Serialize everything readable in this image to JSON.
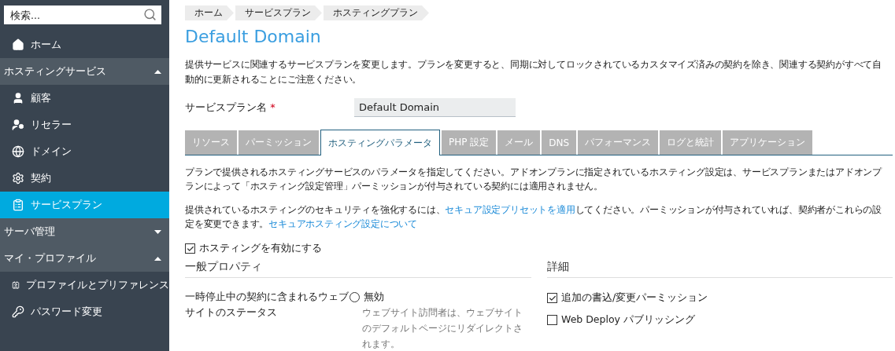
{
  "sidebar": {
    "search": {
      "placeholder": "検索..."
    },
    "nav": [
      {
        "kind": "link",
        "label": "ホーム",
        "selected": false
      },
      {
        "kind": "section",
        "label": "ホスティングサービス",
        "expanded": true,
        "children": [
          {
            "kind": "link",
            "label": "顧客",
            "selected": false
          },
          {
            "kind": "link",
            "label": "リセラー",
            "selected": false
          },
          {
            "kind": "link",
            "label": "ドメイン",
            "selected": false
          },
          {
            "kind": "link",
            "label": "契約",
            "selected": false
          },
          {
            "kind": "link",
            "label": "サービスプラン",
            "selected": true
          }
        ]
      },
      {
        "kind": "section",
        "label": "サーバ管理",
        "expanded": false
      },
      {
        "kind": "section",
        "label": "マイ・プロファイル",
        "expanded": true,
        "children": [
          {
            "kind": "link",
            "label": "プロファイルとプリファレンス",
            "selected": false
          },
          {
            "kind": "link",
            "label": "パスワード変更",
            "selected": false
          }
        ]
      }
    ]
  },
  "breadcrumbs": [
    "ホーム",
    "サービスプラン",
    "ホスティングプラン"
  ],
  "title": "Default Domain",
  "description": "提供サービスに関連するサービスプランを変更します。プランを変更すると、同期に対してロックされているカスタマイズ済みの契約を除き、関連する契約がすべて自動的に更新されることにご注意ください。",
  "plan_name": {
    "label": "サービスプラン名",
    "required_mark": "*",
    "value": "Default Domain"
  },
  "tabs": [
    {
      "label": "リソース",
      "selected": false
    },
    {
      "label": "パーミッション",
      "selected": false
    },
    {
      "label": "ホスティングパラメータ",
      "selected": true
    },
    {
      "label": "PHP 設定",
      "selected": false
    },
    {
      "label": "メール",
      "selected": false
    },
    {
      "label": "DNS",
      "selected": false
    },
    {
      "label": "パフォーマンス",
      "selected": false
    },
    {
      "label": "ログと統計",
      "selected": false
    },
    {
      "label": "アプリケーション",
      "selected": false
    }
  ],
  "paragraphs": [
    [
      {
        "kind": "text",
        "text": "プランで提供されるホスティングサービスのパラメータを指定してください。アドオンプランに指定されているホスティング設定は、サービスプランまたはアドオンプランによって「ホスティング設定管理」パーミッションが付与されている契約には適用されません。"
      }
    ],
    [
      {
        "kind": "text",
        "text": "提供されているホスティングのセキュリティを強化するには、"
      },
      {
        "kind": "link",
        "text": "セキュア設定プリセットを適用"
      },
      {
        "kind": "text",
        "text": "してください。パーミッションが付与されていれば、契約者がこれらの設定を変更できます。"
      },
      {
        "kind": "link",
        "text": "セキュアホスティング設定について"
      }
    ]
  ],
  "enable_hosting": {
    "label": "ホスティングを有効にする",
    "checked": true
  },
  "general": {
    "heading": "一般プロパティ",
    "rows": [
      {
        "label": "一時停止中の契約に含まれるウェブサイトのステータス",
        "options": [
          {
            "label": "無効",
            "selected": false,
            "hint": "ウェブサイト訪問者は、ウェブサイトのデフォルトページにリダイレクトされます。"
          }
        ]
      }
    ]
  },
  "details": {
    "heading": "詳細",
    "options": [
      {
        "label": "追加の書込/変更パーミッション",
        "checked": true
      },
      {
        "label": "Web Deploy パブリッシング",
        "checked": false
      }
    ]
  }
}
